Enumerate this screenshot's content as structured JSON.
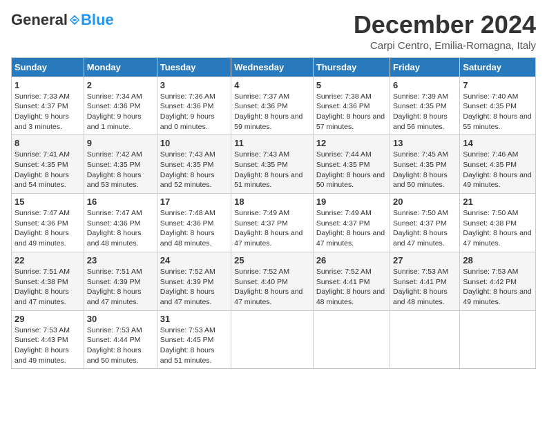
{
  "logo": {
    "general": "General",
    "blue": "Blue"
  },
  "title": "December 2024",
  "location": "Carpi Centro, Emilia-Romagna, Italy",
  "headers": [
    "Sunday",
    "Monday",
    "Tuesday",
    "Wednesday",
    "Thursday",
    "Friday",
    "Saturday"
  ],
  "weeks": [
    [
      {
        "day": "1",
        "sunrise": "Sunrise: 7:33 AM",
        "sunset": "Sunset: 4:37 PM",
        "daylight": "Daylight: 9 hours and 3 minutes."
      },
      {
        "day": "2",
        "sunrise": "Sunrise: 7:34 AM",
        "sunset": "Sunset: 4:36 PM",
        "daylight": "Daylight: 9 hours and 1 minute."
      },
      {
        "day": "3",
        "sunrise": "Sunrise: 7:36 AM",
        "sunset": "Sunset: 4:36 PM",
        "daylight": "Daylight: 9 hours and 0 minutes."
      },
      {
        "day": "4",
        "sunrise": "Sunrise: 7:37 AM",
        "sunset": "Sunset: 4:36 PM",
        "daylight": "Daylight: 8 hours and 59 minutes."
      },
      {
        "day": "5",
        "sunrise": "Sunrise: 7:38 AM",
        "sunset": "Sunset: 4:36 PM",
        "daylight": "Daylight: 8 hours and 57 minutes."
      },
      {
        "day": "6",
        "sunrise": "Sunrise: 7:39 AM",
        "sunset": "Sunset: 4:35 PM",
        "daylight": "Daylight: 8 hours and 56 minutes."
      },
      {
        "day": "7",
        "sunrise": "Sunrise: 7:40 AM",
        "sunset": "Sunset: 4:35 PM",
        "daylight": "Daylight: 8 hours and 55 minutes."
      }
    ],
    [
      {
        "day": "8",
        "sunrise": "Sunrise: 7:41 AM",
        "sunset": "Sunset: 4:35 PM",
        "daylight": "Daylight: 8 hours and 54 minutes."
      },
      {
        "day": "9",
        "sunrise": "Sunrise: 7:42 AM",
        "sunset": "Sunset: 4:35 PM",
        "daylight": "Daylight: 8 hours and 53 minutes."
      },
      {
        "day": "10",
        "sunrise": "Sunrise: 7:43 AM",
        "sunset": "Sunset: 4:35 PM",
        "daylight": "Daylight: 8 hours and 52 minutes."
      },
      {
        "day": "11",
        "sunrise": "Sunrise: 7:43 AM",
        "sunset": "Sunset: 4:35 PM",
        "daylight": "Daylight: 8 hours and 51 minutes."
      },
      {
        "day": "12",
        "sunrise": "Sunrise: 7:44 AM",
        "sunset": "Sunset: 4:35 PM",
        "daylight": "Daylight: 8 hours and 50 minutes."
      },
      {
        "day": "13",
        "sunrise": "Sunrise: 7:45 AM",
        "sunset": "Sunset: 4:35 PM",
        "daylight": "Daylight: 8 hours and 50 minutes."
      },
      {
        "day": "14",
        "sunrise": "Sunrise: 7:46 AM",
        "sunset": "Sunset: 4:35 PM",
        "daylight": "Daylight: 8 hours and 49 minutes."
      }
    ],
    [
      {
        "day": "15",
        "sunrise": "Sunrise: 7:47 AM",
        "sunset": "Sunset: 4:36 PM",
        "daylight": "Daylight: 8 hours and 49 minutes."
      },
      {
        "day": "16",
        "sunrise": "Sunrise: 7:47 AM",
        "sunset": "Sunset: 4:36 PM",
        "daylight": "Daylight: 8 hours and 48 minutes."
      },
      {
        "day": "17",
        "sunrise": "Sunrise: 7:48 AM",
        "sunset": "Sunset: 4:36 PM",
        "daylight": "Daylight: 8 hours and 48 minutes."
      },
      {
        "day": "18",
        "sunrise": "Sunrise: 7:49 AM",
        "sunset": "Sunset: 4:37 PM",
        "daylight": "Daylight: 8 hours and 47 minutes."
      },
      {
        "day": "19",
        "sunrise": "Sunrise: 7:49 AM",
        "sunset": "Sunset: 4:37 PM",
        "daylight": "Daylight: 8 hours and 47 minutes."
      },
      {
        "day": "20",
        "sunrise": "Sunrise: 7:50 AM",
        "sunset": "Sunset: 4:37 PM",
        "daylight": "Daylight: 8 hours and 47 minutes."
      },
      {
        "day": "21",
        "sunrise": "Sunrise: 7:50 AM",
        "sunset": "Sunset: 4:38 PM",
        "daylight": "Daylight: 8 hours and 47 minutes."
      }
    ],
    [
      {
        "day": "22",
        "sunrise": "Sunrise: 7:51 AM",
        "sunset": "Sunset: 4:38 PM",
        "daylight": "Daylight: 8 hours and 47 minutes."
      },
      {
        "day": "23",
        "sunrise": "Sunrise: 7:51 AM",
        "sunset": "Sunset: 4:39 PM",
        "daylight": "Daylight: 8 hours and 47 minutes."
      },
      {
        "day": "24",
        "sunrise": "Sunrise: 7:52 AM",
        "sunset": "Sunset: 4:39 PM",
        "daylight": "Daylight: 8 hours and 47 minutes."
      },
      {
        "day": "25",
        "sunrise": "Sunrise: 7:52 AM",
        "sunset": "Sunset: 4:40 PM",
        "daylight": "Daylight: 8 hours and 47 minutes."
      },
      {
        "day": "26",
        "sunrise": "Sunrise: 7:52 AM",
        "sunset": "Sunset: 4:41 PM",
        "daylight": "Daylight: 8 hours and 48 minutes."
      },
      {
        "day": "27",
        "sunrise": "Sunrise: 7:53 AM",
        "sunset": "Sunset: 4:41 PM",
        "daylight": "Daylight: 8 hours and 48 minutes."
      },
      {
        "day": "28",
        "sunrise": "Sunrise: 7:53 AM",
        "sunset": "Sunset: 4:42 PM",
        "daylight": "Daylight: 8 hours and 49 minutes."
      }
    ],
    [
      {
        "day": "29",
        "sunrise": "Sunrise: 7:53 AM",
        "sunset": "Sunset: 4:43 PM",
        "daylight": "Daylight: 8 hours and 49 minutes."
      },
      {
        "day": "30",
        "sunrise": "Sunrise: 7:53 AM",
        "sunset": "Sunset: 4:44 PM",
        "daylight": "Daylight: 8 hours and 50 minutes."
      },
      {
        "day": "31",
        "sunrise": "Sunrise: 7:53 AM",
        "sunset": "Sunset: 4:45 PM",
        "daylight": "Daylight: 8 hours and 51 minutes."
      },
      null,
      null,
      null,
      null
    ]
  ]
}
